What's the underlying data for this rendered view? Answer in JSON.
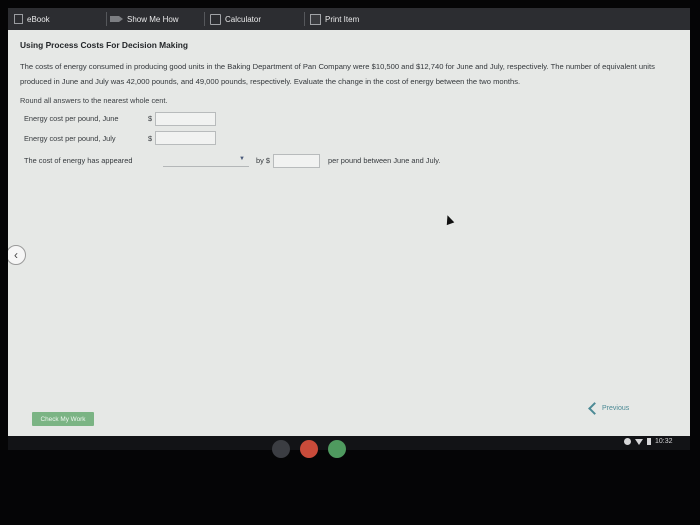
{
  "toolbar": {
    "ebook": "eBook",
    "show_me_how": "Show Me How",
    "calculator": "Calculator",
    "print_item": "Print Item"
  },
  "question": {
    "title": "Using Process Costs For Decision Making",
    "text": "The costs of energy consumed in producing good units in the Baking Department of Pan Company were $10,500 and $12,740 for June and July, respectively. The number of equivalent units produced in June and July was 42,000 pounds, and 49,000 pounds, respectively. Evaluate the change in the cost of energy between the two months.",
    "round_note": "Round all answers to the nearest whole cent.",
    "june_label": "Energy cost per pound, June",
    "july_label": "Energy cost per pound, July",
    "currency": "$",
    "june_value": "",
    "july_value": "",
    "appeared_label": "The cost of energy has appeared",
    "appeared_selected": "",
    "by_label": "by $",
    "change_value": "",
    "after_label": "per pound between June and July."
  },
  "footer": {
    "check_my_work": "Check My Work",
    "previous": "Previous"
  },
  "system": {
    "time": "10:32"
  },
  "colors": {
    "toolbar_bg": "#2c2d31",
    "check_button": "#7bb484",
    "previous_link": "#4c8a95"
  }
}
